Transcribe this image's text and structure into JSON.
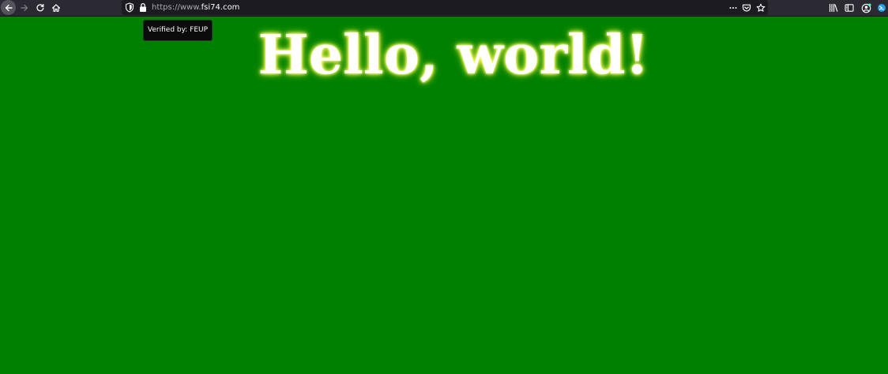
{
  "browser": {
    "url_prefix": "https://www.",
    "url_domain": "fsi74.com",
    "tooltip": "Verified by: FEUP",
    "icons": {
      "back": "arrow-left-icon",
      "forward": "arrow-right-icon",
      "reload": "reload-icon",
      "home": "home-icon",
      "tracking_protection": "shield-icon",
      "lock": "lock-icon",
      "page_actions": "more-horizontal-icon",
      "pocket": "pocket-icon",
      "bookmark": "star-icon",
      "library": "library-icon",
      "sidebar": "sidebar-icon",
      "account": "account-icon",
      "extension": "extension-icon"
    }
  },
  "page": {
    "heading": "Hello, world!",
    "background_color": "#008000",
    "heading_color": "#ffffff",
    "heading_glow_color": "#ffff66"
  }
}
